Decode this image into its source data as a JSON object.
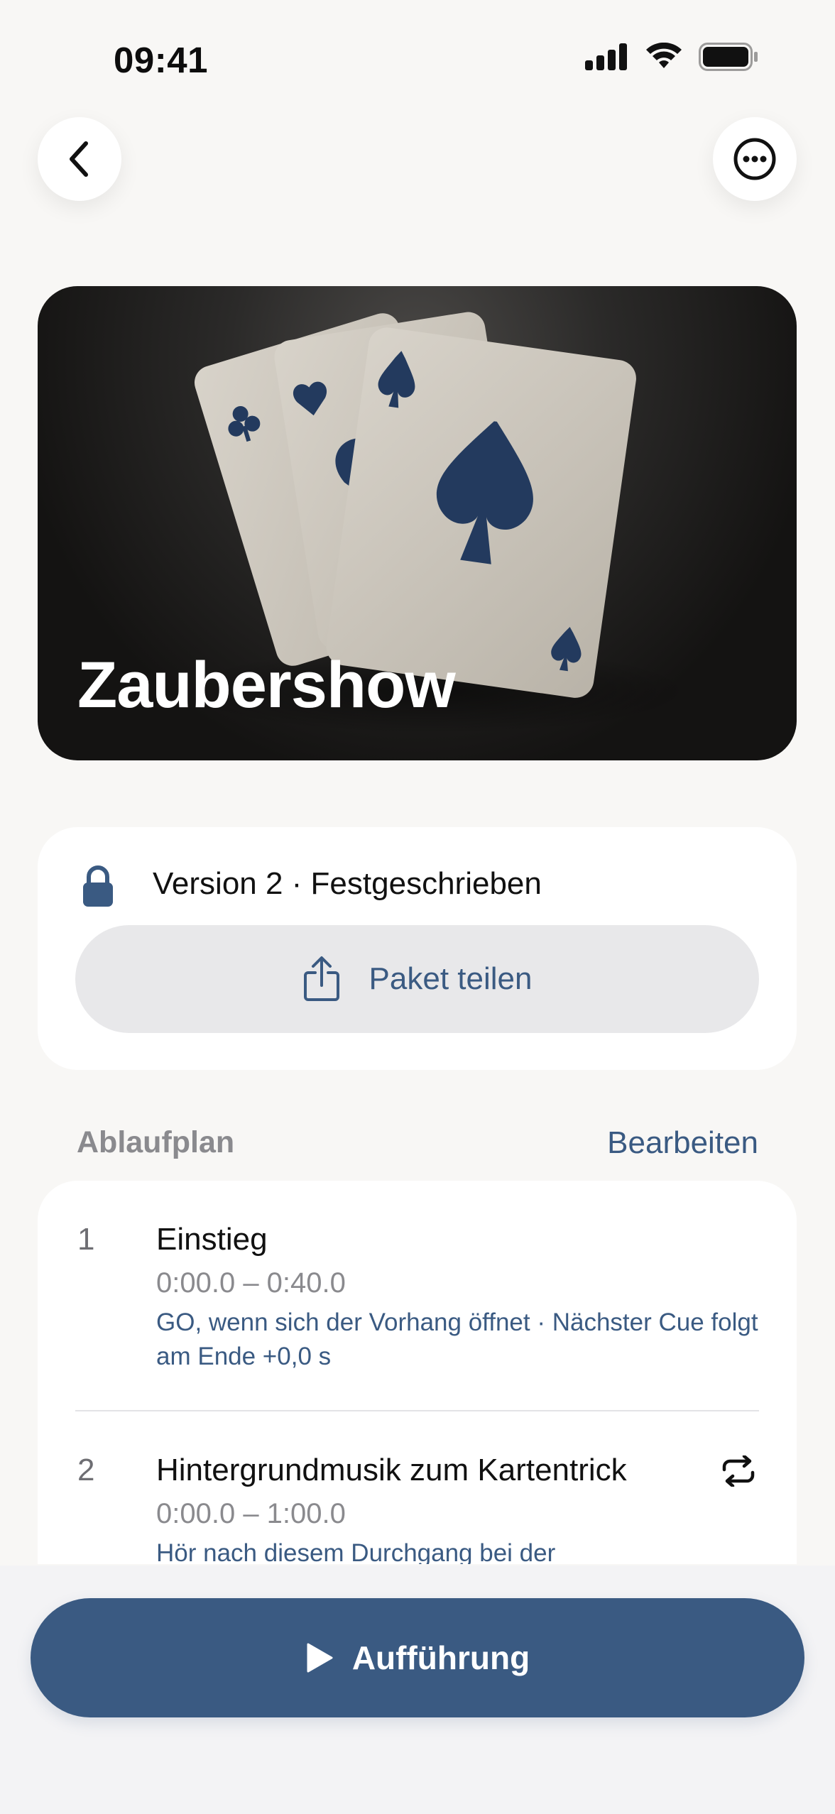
{
  "status_bar": {
    "time": "09:41",
    "icons": [
      "signal-icon",
      "wifi-icon",
      "battery-icon"
    ]
  },
  "nav": {
    "back_icon": "chevron-left-icon",
    "more_icon": "ellipsis-circle-icon"
  },
  "hero": {
    "title": "Zaubershow"
  },
  "version": {
    "icon": "lock-icon",
    "text": "Version 2 · Festgeschrieben",
    "share_label": "Paket teilen",
    "share_icon": "share-icon"
  },
  "section": {
    "title": "Ablaufplan",
    "action": "Bearbeiten"
  },
  "cues": [
    {
      "number": "1",
      "title": "Einstieg",
      "time": "0:00.0 – 0:40.0",
      "note": "GO, wenn sich der Vorhang öffnet · Nächster Cue folgt am Ende +0,0 s"
    },
    {
      "number": "2",
      "title": "Hintergrundmusik zum Kartentrick",
      "time": "0:00.0 – 1:00.0",
      "note": "Hör nach diesem Durchgang bei der",
      "icon": "repeat-icon"
    }
  ],
  "footer": {
    "perform_label": "Aufführung",
    "perform_icon": "play-icon"
  },
  "colors": {
    "accent": "#3a5a82",
    "background": "#f8f7f5",
    "card": "#ffffff"
  }
}
